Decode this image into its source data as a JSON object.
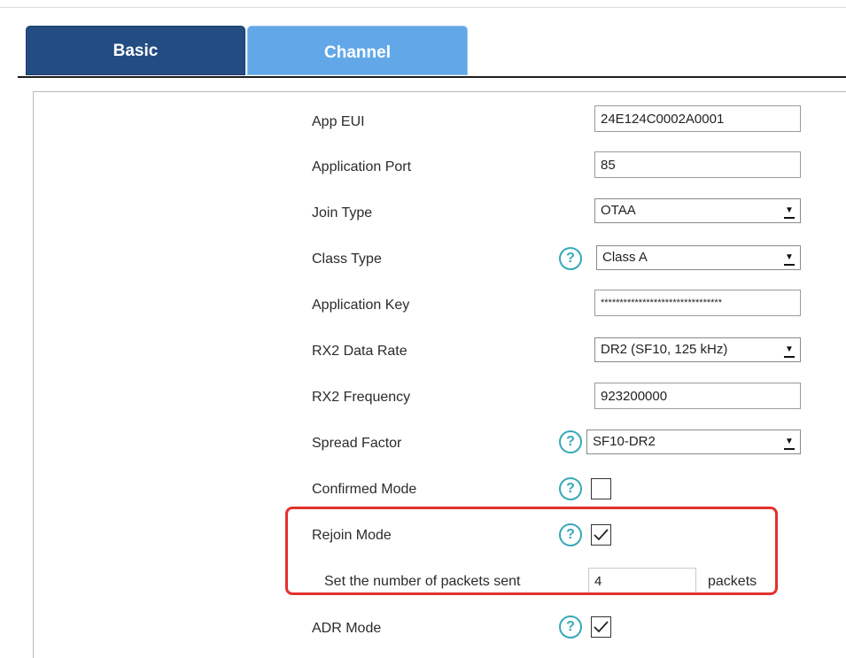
{
  "tabs": {
    "basic": "Basic",
    "channel": "Channel"
  },
  "fields": {
    "app_eui": {
      "label": "App EUI",
      "value": "24E124C0002A0001"
    },
    "application_port": {
      "label": "Application Port",
      "value": "85"
    },
    "join_type": {
      "label": "Join Type",
      "value": "OTAA"
    },
    "class_type": {
      "label": "Class Type",
      "value": "Class A"
    },
    "application_key": {
      "label": "Application Key",
      "value": "********************************"
    },
    "rx2_data_rate": {
      "label": "RX2 Data Rate",
      "value": "DR2 (SF10, 125 kHz)"
    },
    "rx2_frequency": {
      "label": "RX2 Frequency",
      "value": "923200000"
    },
    "spread_factor": {
      "label": "Spread Factor",
      "value": "SF10-DR2"
    },
    "confirmed_mode": {
      "label": "Confirmed Mode",
      "checked": false
    },
    "rejoin_mode": {
      "label": "Rejoin Mode",
      "checked": true
    },
    "packets": {
      "label": "Set the number of packets sent",
      "value": "4",
      "unit": "packets"
    },
    "adr_mode": {
      "label": "ADR Mode",
      "checked": true
    }
  },
  "icons": {
    "help": "?",
    "dropdown": "▼"
  },
  "colors": {
    "tab_active": "#234d82",
    "tab_inactive": "#62a8e8",
    "help_icon": "#35a9b8",
    "highlight": "#e3312d"
  }
}
